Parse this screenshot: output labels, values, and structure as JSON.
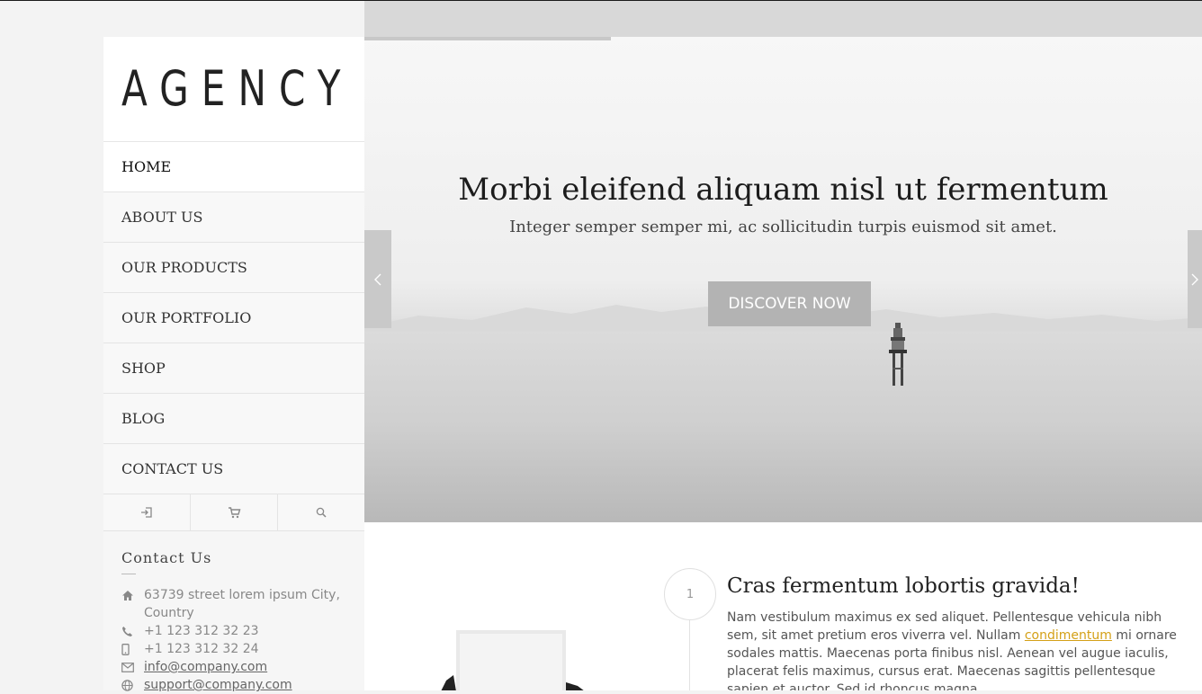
{
  "brand": {
    "logo": "AGENCY"
  },
  "nav": {
    "items": [
      {
        "label": "HOME",
        "active": true
      },
      {
        "label": "ABOUT US"
      },
      {
        "label": "OUR PRODUCTS"
      },
      {
        "label": "OUR PORTFOLIO"
      },
      {
        "label": "SHOP"
      },
      {
        "label": "BLOG"
      },
      {
        "label": "CONTACT US"
      }
    ],
    "icons": [
      "sign-in-icon",
      "cart-icon",
      "search-icon"
    ]
  },
  "contact": {
    "title": "Contact Us",
    "address": "63739 street lorem ipsum City, Country",
    "phone": "+1 123 312 32 23",
    "mobile": "+1 123 312 32 24",
    "email": "info@company.com",
    "support": "support@company.com"
  },
  "hero": {
    "title": "Morbi eleifend aliquam nisl ut fermentum",
    "subtitle": "Integer semper semper mi, ac sollicitudin turpis euismod sit amet.",
    "button": "DISCOVER NOW",
    "prev_icon": "chevron-left-icon",
    "next_icon": "chevron-right-icon"
  },
  "feature": {
    "step": "1",
    "title": "Cras fermentum lobortis gravida!",
    "text_before": "Nam vestibulum maximus ex sed aliquet. Pellentesque vehicula nibh sem, sit amet pretium eros viverra vel. Nullam ",
    "link": "condimentum",
    "text_after": " mi ornare sodales mattis. Maecenas porta finibus nisl. Aenean vel augue iaculis, placerat felis maximus, cursus erat. Maecenas sagittis pellentesque sapien et auctor. Sed id rhoncus magna."
  },
  "colors": {
    "accent_link": "#d4a017",
    "button_bg": "#b3b3b3"
  }
}
